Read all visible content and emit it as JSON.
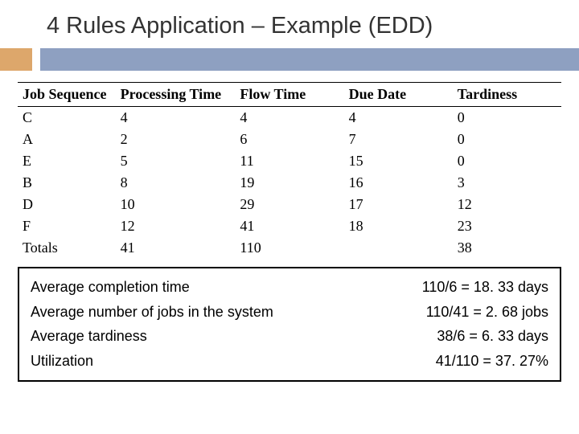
{
  "title": "4 Rules Application – Example (EDD)",
  "table": {
    "headers": [
      "Job Sequence",
      "Processing Time",
      "Flow Time",
      "Due Date",
      "Tardiness"
    ],
    "rows": [
      {
        "job": "C",
        "proc": "4",
        "flow": "4",
        "due": "4",
        "tardy": "0"
      },
      {
        "job": "A",
        "proc": "2",
        "flow": "6",
        "due": "7",
        "tardy": "0"
      },
      {
        "job": "E",
        "proc": "5",
        "flow": "11",
        "due": "15",
        "tardy": "0"
      },
      {
        "job": "B",
        "proc": "8",
        "flow": "19",
        "due": "16",
        "tardy": "3"
      },
      {
        "job": "D",
        "proc": "10",
        "flow": "29",
        "due": "17",
        "tardy": "12"
      },
      {
        "job": "F",
        "proc": "12",
        "flow": "41",
        "due": "18",
        "tardy": "23"
      }
    ],
    "totals": {
      "label": "Totals",
      "proc": "41",
      "flow": "110",
      "due": "",
      "tardy": "38"
    }
  },
  "summary": [
    {
      "label": "Average completion time",
      "value": "110/6 = 18. 33 days"
    },
    {
      "label": "Average number of jobs in the system",
      "value": "110/41 = 2. 68 jobs"
    },
    {
      "label": "Average tardiness",
      "value": "38/6 = 6. 33 days"
    },
    {
      "label": "Utilization",
      "value": "41/110 = 37. 27%"
    }
  ],
  "chart_data": {
    "type": "table",
    "title": "4 Rules Application – Example (EDD)",
    "columns": [
      "Job Sequence",
      "Processing Time",
      "Flow Time",
      "Due Date",
      "Tardiness"
    ],
    "rows": [
      [
        "C",
        4,
        4,
        4,
        0
      ],
      [
        "A",
        2,
        6,
        7,
        0
      ],
      [
        "E",
        5,
        11,
        15,
        0
      ],
      [
        "B",
        8,
        19,
        16,
        3
      ],
      [
        "D",
        10,
        29,
        17,
        12
      ],
      [
        "F",
        12,
        41,
        18,
        23
      ]
    ],
    "totals": {
      "Processing Time": 41,
      "Flow Time": 110,
      "Tardiness": 38
    },
    "derived": {
      "average_completion_time_days": 18.33,
      "average_jobs_in_system": 2.68,
      "average_tardiness_days": 6.33,
      "utilization_pct": 37.27
    }
  }
}
